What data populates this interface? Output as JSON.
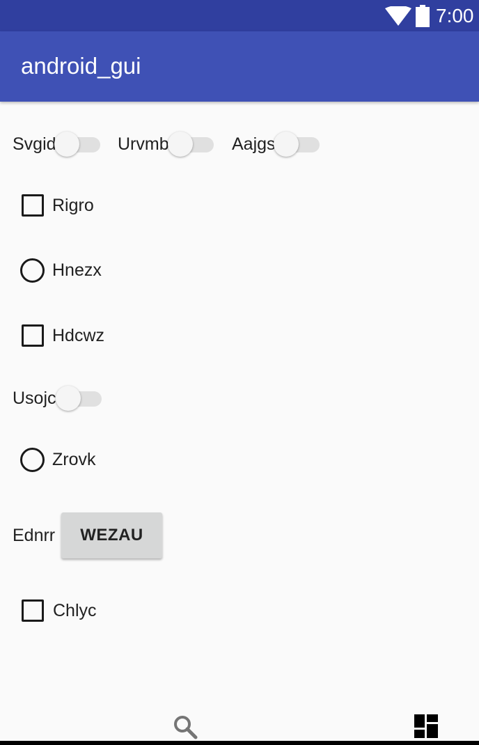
{
  "status_bar": {
    "time": "7:00",
    "icons": [
      "wifi-icon",
      "battery-icon"
    ]
  },
  "app_bar": {
    "title": "android_gui"
  },
  "controls": {
    "switch_svgid": {
      "label": "Svgid",
      "checked": false
    },
    "switch_urvmb": {
      "label": "Urvmb",
      "checked": false
    },
    "switch_aajgs": {
      "label": "Aajgs",
      "checked": false
    },
    "checkbox_rigro": {
      "label": "Rigro",
      "checked": false
    },
    "radio_hnezx": {
      "label": "Hnezx",
      "checked": false
    },
    "checkbox_hdcwz": {
      "label": "Hdcwz",
      "checked": false
    },
    "switch_usojc": {
      "label": "Usojc",
      "checked": false
    },
    "radio_zrovk": {
      "label": "Zrovk",
      "checked": false
    },
    "ednrr": {
      "label": "Ednrr",
      "button_label": "WEZAU"
    },
    "checkbox_chlyc": {
      "label": "Chlyc",
      "checked": false
    }
  },
  "bottom_nav": {
    "icons": [
      "search-icon",
      "dashboard-icon"
    ]
  },
  "colors": {
    "status_bar": "#303f9f",
    "app_bar": "#3f51b5",
    "background": "#fafafa",
    "button": "#d6d7d7"
  }
}
